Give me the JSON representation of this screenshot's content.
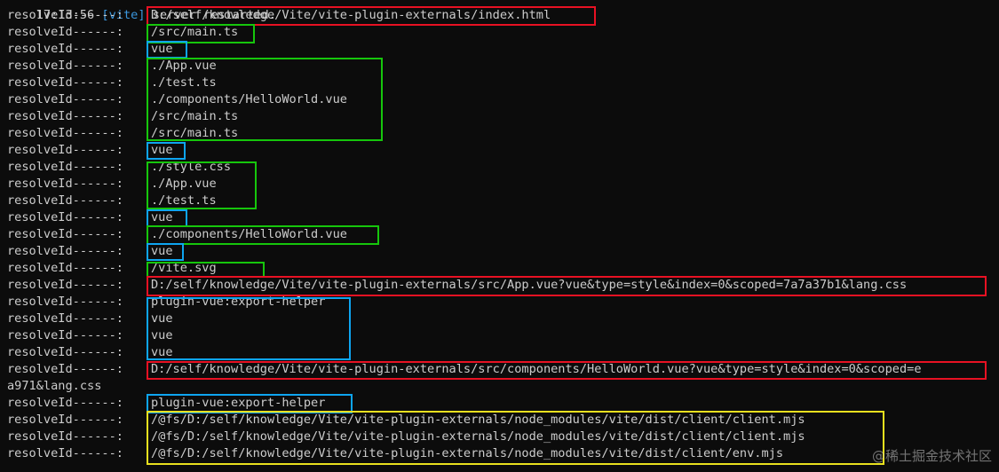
{
  "header": {
    "time": "17:13:56",
    "tag": "[vite]",
    "message": "server restarted."
  },
  "lines": [
    {
      "prefix": "resolveId------:",
      "path": "D:/self/knowledge/Vite/vite-plugin-externals/index.html"
    },
    {
      "prefix": "resolveId------:",
      "path": "/src/main.ts"
    },
    {
      "prefix": "resolveId------:",
      "path": "vue"
    },
    {
      "prefix": "resolveId------:",
      "path": "./App.vue"
    },
    {
      "prefix": "resolveId------:",
      "path": "./test.ts"
    },
    {
      "prefix": "resolveId------:",
      "path": "./components/HelloWorld.vue"
    },
    {
      "prefix": "resolveId------:",
      "path": "/src/main.ts"
    },
    {
      "prefix": "resolveId------:",
      "path": "/src/main.ts"
    },
    {
      "prefix": "resolveId------:",
      "path": "vue"
    },
    {
      "prefix": "resolveId------:",
      "path": "./style.css"
    },
    {
      "prefix": "resolveId------:",
      "path": "./App.vue"
    },
    {
      "prefix": "resolveId------:",
      "path": "./test.ts"
    },
    {
      "prefix": "resolveId------:",
      "path": "vue"
    },
    {
      "prefix": "resolveId------:",
      "path": "./components/HelloWorld.vue"
    },
    {
      "prefix": "resolveId------:",
      "path": "vue"
    },
    {
      "prefix": "resolveId------:",
      "path": "/vite.svg"
    },
    {
      "prefix": "resolveId------:",
      "path": "D:/self/knowledge/Vite/vite-plugin-externals/src/App.vue?vue&type=style&index=0&scoped=7a7a37b1&lang.css"
    },
    {
      "prefix": "resolveId------:",
      "path": "plugin-vue:export-helper"
    },
    {
      "prefix": "resolveId------:",
      "path": "vue"
    },
    {
      "prefix": "resolveId------:",
      "path": "vue"
    },
    {
      "prefix": "resolveId------:",
      "path": "vue"
    },
    {
      "prefix": "resolveId------:",
      "path": "D:/self/knowledge/Vite/vite-plugin-externals/src/components/HelloWorld.vue?vue&type=style&index=0&scoped=e"
    },
    {
      "prefix": "",
      "path": "a971&lang.css"
    },
    {
      "prefix": "resolveId------:",
      "path": "plugin-vue:export-helper"
    },
    {
      "prefix": "resolveId------:",
      "path": "/@fs/D:/self/knowledge/Vite/vite-plugin-externals/node_modules/vite/dist/client/client.mjs"
    },
    {
      "prefix": "resolveId------:",
      "path": "/@fs/D:/self/knowledge/Vite/vite-plugin-externals/node_modules/vite/dist/client/client.mjs"
    },
    {
      "prefix": "resolveId------:",
      "path": "/@fs/D:/self/knowledge/Vite/vite-plugin-externals/node_modules/vite/dist/client/env.mjs"
    }
  ],
  "watermark": "@稀土掘金技术社区",
  "colors": {
    "background": "#0c0c0c",
    "text": "#cccccc",
    "red_box": "#e81123",
    "green_box": "#16c60c",
    "blue_box": "#0ea5f0",
    "yellow_box": "#e8e01e"
  }
}
